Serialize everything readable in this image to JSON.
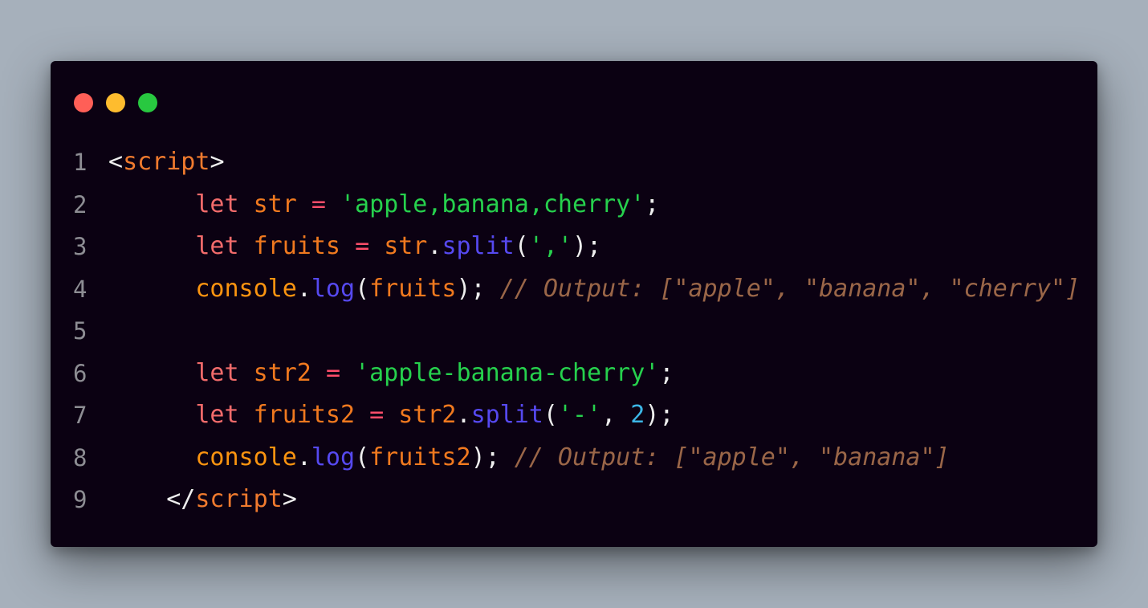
{
  "window": {
    "controls": [
      {
        "name": "close",
        "color": "#ff5f57"
      },
      {
        "name": "minimize",
        "color": "#febc2e"
      },
      {
        "name": "zoom",
        "color": "#28c840"
      }
    ]
  },
  "code": {
    "lines": [
      {
        "number": "1",
        "tokens": [
          {
            "t": "<",
            "k": "punct"
          },
          {
            "t": "script",
            "k": "tag"
          },
          {
            "t": ">",
            "k": "punct"
          }
        ]
      },
      {
        "number": "2",
        "tokens": [
          {
            "t": "      ",
            "k": "ws"
          },
          {
            "t": "let",
            "k": "kw"
          },
          {
            "t": " ",
            "k": "ws"
          },
          {
            "t": "str",
            "k": "var"
          },
          {
            "t": " ",
            "k": "ws"
          },
          {
            "t": "=",
            "k": "op"
          },
          {
            "t": " ",
            "k": "ws"
          },
          {
            "t": "'apple,banana,cherry'",
            "k": "str"
          },
          {
            "t": ";",
            "k": "punct"
          }
        ]
      },
      {
        "number": "3",
        "tokens": [
          {
            "t": "      ",
            "k": "ws"
          },
          {
            "t": "let",
            "k": "kw"
          },
          {
            "t": " ",
            "k": "ws"
          },
          {
            "t": "fruits",
            "k": "var"
          },
          {
            "t": " ",
            "k": "ws"
          },
          {
            "t": "=",
            "k": "op"
          },
          {
            "t": " ",
            "k": "ws"
          },
          {
            "t": "str",
            "k": "var"
          },
          {
            "t": ".",
            "k": "punct"
          },
          {
            "t": "split",
            "k": "fn"
          },
          {
            "t": "(",
            "k": "punct"
          },
          {
            "t": "','",
            "k": "str"
          },
          {
            "t": ");",
            "k": "punct"
          }
        ]
      },
      {
        "number": "4",
        "tokens": [
          {
            "t": "      ",
            "k": "ws"
          },
          {
            "t": "console",
            "k": "obj"
          },
          {
            "t": ".",
            "k": "punct"
          },
          {
            "t": "log",
            "k": "fn"
          },
          {
            "t": "(",
            "k": "punct"
          },
          {
            "t": "fruits",
            "k": "var"
          },
          {
            "t": ");",
            "k": "punct"
          },
          {
            "t": " ",
            "k": "ws"
          },
          {
            "t": "// Output: [\"apple\", \"banana\", \"cherry\"]",
            "k": "cm"
          }
        ]
      },
      {
        "number": "5",
        "tokens": []
      },
      {
        "number": "6",
        "tokens": [
          {
            "t": "      ",
            "k": "ws"
          },
          {
            "t": "let",
            "k": "kw"
          },
          {
            "t": " ",
            "k": "ws"
          },
          {
            "t": "str2",
            "k": "var"
          },
          {
            "t": " ",
            "k": "ws"
          },
          {
            "t": "=",
            "k": "op"
          },
          {
            "t": " ",
            "k": "ws"
          },
          {
            "t": "'apple-banana-cherry'",
            "k": "str"
          },
          {
            "t": ";",
            "k": "punct"
          }
        ]
      },
      {
        "number": "7",
        "tokens": [
          {
            "t": "      ",
            "k": "ws"
          },
          {
            "t": "let",
            "k": "kw"
          },
          {
            "t": " ",
            "k": "ws"
          },
          {
            "t": "fruits2",
            "k": "var"
          },
          {
            "t": " ",
            "k": "ws"
          },
          {
            "t": "=",
            "k": "op"
          },
          {
            "t": " ",
            "k": "ws"
          },
          {
            "t": "str2",
            "k": "var"
          },
          {
            "t": ".",
            "k": "punct"
          },
          {
            "t": "split",
            "k": "fn"
          },
          {
            "t": "(",
            "k": "punct"
          },
          {
            "t": "'-'",
            "k": "str"
          },
          {
            "t": ", ",
            "k": "punct"
          },
          {
            "t": "2",
            "k": "num"
          },
          {
            "t": ");",
            "k": "punct"
          }
        ]
      },
      {
        "number": "8",
        "tokens": [
          {
            "t": "      ",
            "k": "ws"
          },
          {
            "t": "console",
            "k": "obj"
          },
          {
            "t": ".",
            "k": "punct"
          },
          {
            "t": "log",
            "k": "fn"
          },
          {
            "t": "(",
            "k": "punct"
          },
          {
            "t": "fruits2",
            "k": "var"
          },
          {
            "t": ");",
            "k": "punct"
          },
          {
            "t": " ",
            "k": "ws"
          },
          {
            "t": "// Output: [\"apple\", \"banana\"]",
            "k": "cm"
          }
        ]
      },
      {
        "number": "9",
        "tokens": [
          {
            "t": "    ",
            "k": "ws"
          },
          {
            "t": "</",
            "k": "punct"
          },
          {
            "t": "script",
            "k": "tag"
          },
          {
            "t": ">",
            "k": "punct"
          }
        ]
      }
    ]
  }
}
